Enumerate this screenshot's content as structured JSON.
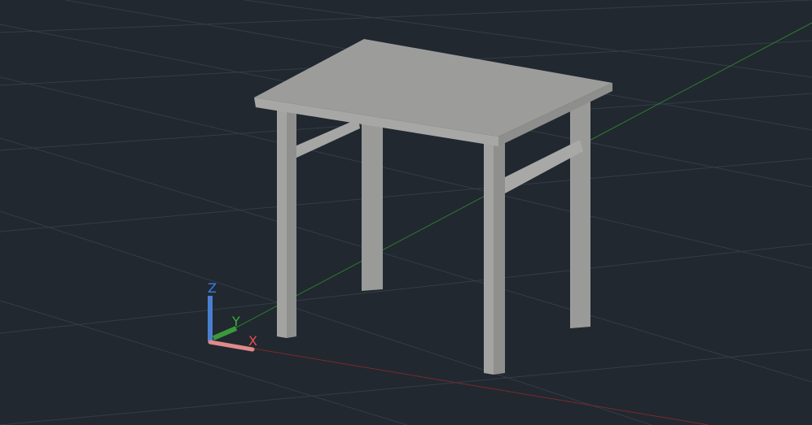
{
  "viewport": {
    "background": "#212830",
    "grid_color": "#343c47",
    "model": "table"
  },
  "ucs": {
    "x_label": "X",
    "y_label": "Y",
    "z_label": "Z",
    "x_color": "#e05050",
    "y_color": "#2fb52f",
    "z_color": "#3a7de0"
  }
}
